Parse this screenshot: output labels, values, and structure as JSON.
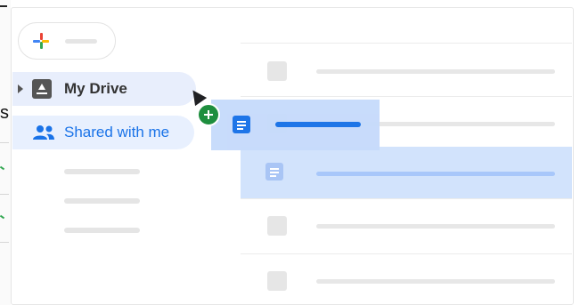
{
  "background": {
    "fragment_text": "s"
  },
  "sidebar": {
    "new_button_label": "",
    "items": [
      {
        "label": "My Drive",
        "icon": "drive-icon"
      },
      {
        "label": "Shared with me",
        "icon": "people-icon"
      }
    ]
  },
  "colors": {
    "accent": "#1a73e8",
    "selected_row": "#d2e3fc",
    "drag_ghost": "#c7dbfb",
    "add_badge": "#1e8e3e"
  }
}
